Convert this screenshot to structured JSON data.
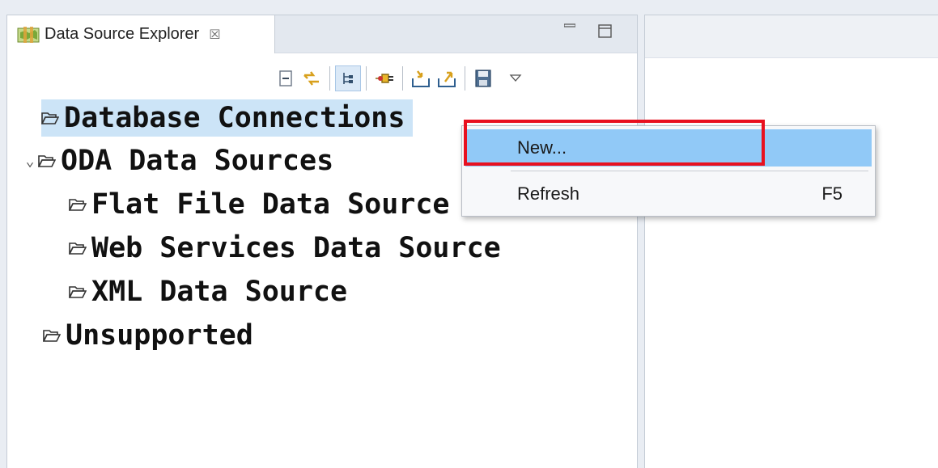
{
  "view": {
    "tab_title": "Data Source Explorer",
    "tab_close_glyph": "☒",
    "tab_icon": "data-source-explorer-icon",
    "minimize_icon": "minimize-icon",
    "maximize_icon": "maximize-icon"
  },
  "toolbar": {
    "icons": [
      "collapse-all-icon",
      "link-with-editor-icon",
      "tree-layout-icon",
      "connect-icon",
      "import-icon",
      "export-icon",
      "save-icon",
      "view-menu-icon"
    ]
  },
  "tree": {
    "nodes": [
      {
        "label": "Database Connections",
        "selected": true
      },
      {
        "label": "ODA Data Sources",
        "expanded": true,
        "twisty": "⌄"
      },
      {
        "label": "Flat File Data Source"
      },
      {
        "label": "Web Services Data Source"
      },
      {
        "label": "XML Data Source"
      },
      {
        "label": "Unsupported"
      }
    ]
  },
  "context_menu": {
    "items": [
      {
        "label": "New...",
        "accelerator": ""
      },
      {
        "label": "Refresh",
        "accelerator": "F5"
      }
    ]
  },
  "colors": {
    "selection": "#cce4f7",
    "menu_highlight": "#91c9f7",
    "annotation": "#e8101f"
  }
}
